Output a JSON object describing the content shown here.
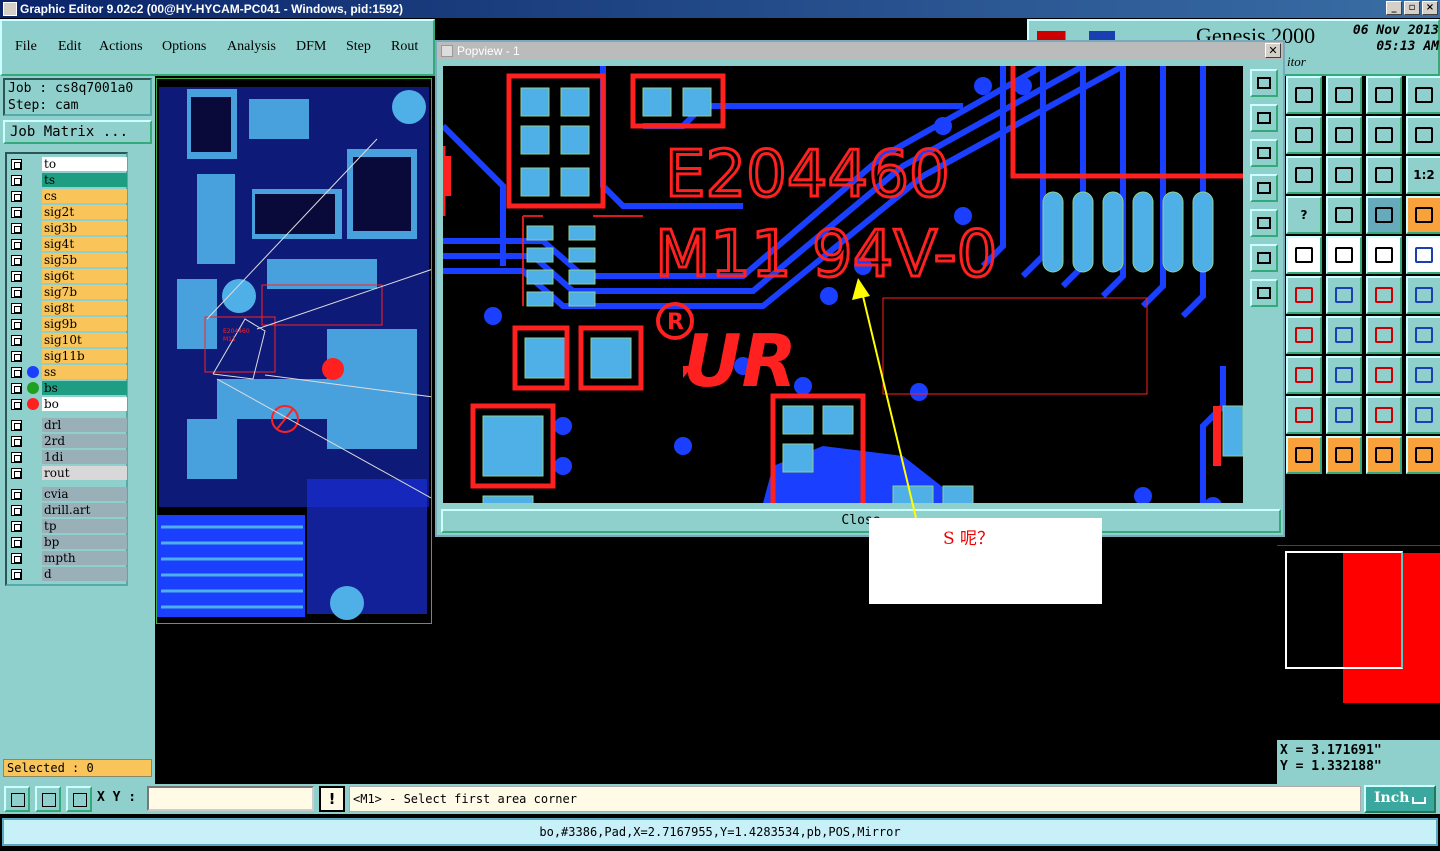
{
  "window": {
    "title": "Graphic Editor 9.02c2 (00@HY-HYCAM-PC041 - Windows, pid:1592)",
    "min": "_",
    "max": "▫",
    "close": "×"
  },
  "menu": [
    "File",
    "Edit",
    "Actions",
    "Options",
    "Analysis",
    "DFM",
    "Step",
    "Rout"
  ],
  "brand": {
    "name": "Genesis 2000",
    "subtitle": "itor",
    "date": "06 Nov 2013",
    "time": "05:13 AM"
  },
  "job": {
    "job": "Job : cs8q7001a0",
    "step": "Step: cam",
    "matrix": "Job Matrix ..."
  },
  "layers_board": [
    {
      "name": "to",
      "color": "#ffffff",
      "dot": "",
      "lock": true
    },
    {
      "name": "ts",
      "color": "#1f9d82",
      "dot": "",
      "lock": false
    },
    {
      "name": "cs",
      "color": "#f9c45a",
      "dot": "",
      "lock": false
    },
    {
      "name": "sig2t",
      "color": "#f9c45a",
      "dot": "",
      "lock": true
    },
    {
      "name": "sig3b",
      "color": "#f9c45a",
      "dot": "",
      "lock": false
    },
    {
      "name": "sig4t",
      "color": "#f9c45a",
      "dot": "",
      "lock": true
    },
    {
      "name": "sig5b",
      "color": "#f9c45a",
      "dot": "",
      "lock": false
    },
    {
      "name": "sig6t",
      "color": "#f9c45a",
      "dot": "",
      "lock": true
    },
    {
      "name": "sig7b",
      "color": "#f9c45a",
      "dot": "",
      "lock": true
    },
    {
      "name": "sig8t",
      "color": "#f9c45a",
      "dot": "",
      "lock": false
    },
    {
      "name": "sig9b",
      "color": "#f9c45a",
      "dot": "",
      "lock": true
    },
    {
      "name": "sig10t",
      "color": "#f9c45a",
      "dot": "",
      "lock": false
    },
    {
      "name": "sig11b",
      "color": "#f9c45a",
      "dot": "",
      "lock": true
    },
    {
      "name": "ss",
      "color": "#f9c45a",
      "dot": "#1a3fff",
      "lock": false
    },
    {
      "name": "bs",
      "color": "#1f9d82",
      "dot": "#20a020",
      "lock": false
    },
    {
      "name": "bo",
      "color": "#ffffff",
      "dot": "#ff2020",
      "lock": true
    }
  ],
  "layers_drill": [
    {
      "name": "drl",
      "color": "#9ab0b8"
    },
    {
      "name": "2rd",
      "color": "#9ab0b8"
    },
    {
      "name": "1di",
      "color": "#9ab0b8"
    },
    {
      "name": "rout",
      "color": "#d8d8d8"
    }
  ],
  "layers_misc": [
    {
      "name": "cvia",
      "color": "#9ab0b8"
    },
    {
      "name": "drill.art",
      "color": "#9ab0b8"
    },
    {
      "name": "tp",
      "color": "#9ab0b8"
    },
    {
      "name": "bp",
      "color": "#9ab0b8"
    },
    {
      "name": "mpth",
      "color": "#9ab0b8"
    },
    {
      "name": "d",
      "color": "#9ab0b8"
    }
  ],
  "selected": "Selected : 0",
  "popview": {
    "title": "Popview - 1",
    "close": "Close",
    "text1": "E204460",
    "text2": "M11 94V-0",
    "reg": "R",
    "logo": "UR"
  },
  "coords": {
    "x": "X = 3.171691\"",
    "y": "Y = 1.332188\""
  },
  "bottom": {
    "xy_label": "X Y :",
    "xy_value": "",
    "warn": "!",
    "message": "<M1> - Select first area corner",
    "units": "Inch"
  },
  "status": "bo,#3386,Pad,X=2.7167955,Y=1.4283534,pb,POS,Mirror",
  "annotation": "S 呢？",
  "tools": [
    "",
    "",
    "",
    "",
    "",
    "",
    "",
    "",
    "",
    "",
    "",
    "1:2",
    "?",
    "",
    "",
    "",
    "",
    "",
    "",
    "",
    "",
    "",
    "",
    "",
    "",
    "",
    "",
    "",
    "",
    "",
    "",
    "",
    "",
    "",
    "",
    "",
    "",
    "",
    "",
    ""
  ]
}
